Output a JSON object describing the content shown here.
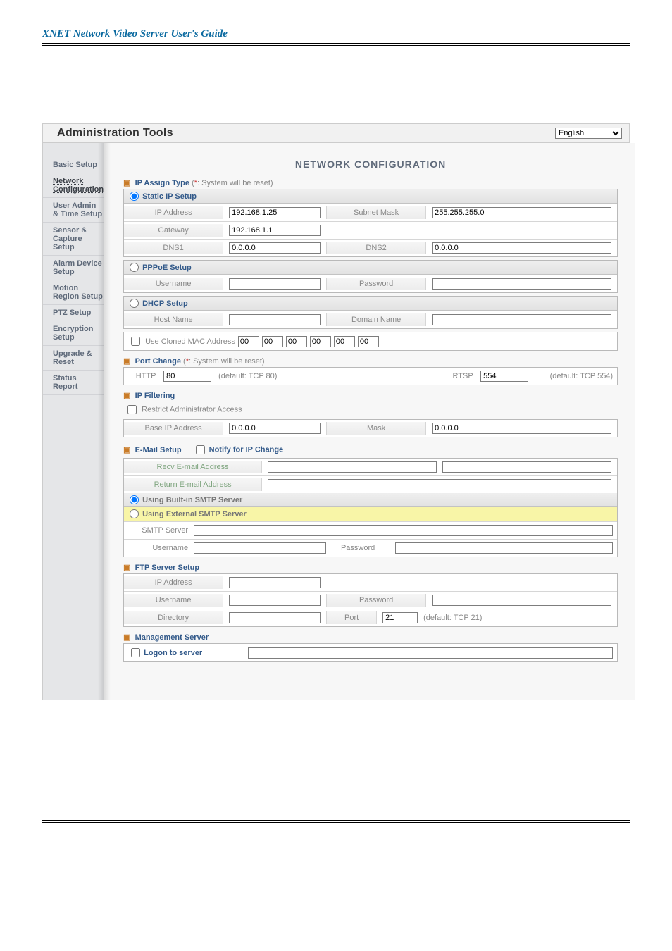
{
  "doc_title": "XNET Network Video Server User's Guide",
  "header": {
    "title": "Administration Tools",
    "language": "English"
  },
  "sidebar": {
    "items": [
      {
        "label": "Basic Setup"
      },
      {
        "label": "Network Configuration"
      },
      {
        "label": "User Admin & Time Setup"
      },
      {
        "label": "Sensor & Capture Setup"
      },
      {
        "label": "Alarm Device Setup"
      },
      {
        "label": "Motion Region Setup"
      },
      {
        "label": "PTZ Setup"
      },
      {
        "label": "Encryption Setup"
      },
      {
        "label": "Upgrade & Reset"
      },
      {
        "label": "Status Report"
      }
    ],
    "active_index": 1
  },
  "page_title": "NETWORK CONFIGURATION",
  "ip_assign": {
    "title": "IP Assign Type",
    "note_prefix": "*",
    "note_text": ": System will be reset)",
    "note_open": "(",
    "static": {
      "title": "Static IP Setup",
      "ip_label": "IP Address",
      "ip_value": "192.168.1.25",
      "subnet_label": "Subnet Mask",
      "subnet_value": "255.255.255.0",
      "gateway_label": "Gateway",
      "gateway_value": "192.168.1.1",
      "dns1_label": "DNS1",
      "dns1_value": "0.0.0.0",
      "dns2_label": "DNS2",
      "dns2_value": "0.0.0.0"
    },
    "pppoe": {
      "title": "PPPoE Setup",
      "user_label": "Username",
      "user_value": "",
      "pass_label": "Password",
      "pass_value": ""
    },
    "dhcp": {
      "title": "DHCP Setup",
      "host_label": "Host Name",
      "host_value": "",
      "domain_label": "Domain Name",
      "domain_value": ""
    },
    "mac": {
      "label": "Use Cloned MAC Address",
      "oct": [
        "00",
        "00",
        "00",
        "00",
        "00",
        "00"
      ]
    }
  },
  "port_change": {
    "title": "Port Change",
    "note_prefix": "*",
    "note_text": ": System will be reset)",
    "note_open": "(",
    "http_label": "HTTP",
    "http_value": "80",
    "http_hint": "(default: TCP 80)",
    "rtsp_label": "RTSP",
    "rtsp_value": "554",
    "rtsp_hint": "(default: TCP 554)"
  },
  "ip_filtering": {
    "title": "IP Filtering",
    "restrict_label": "Restrict Administrator Access",
    "base_label": "Base IP Address",
    "base_value": "0.0.0.0",
    "mask_label": "Mask",
    "mask_value": "0.0.0.0"
  },
  "email": {
    "title": "E-Mail Setup",
    "notify_label": "Notify for IP Change",
    "recv_label": "Recv E-mail Address",
    "recv_value": "",
    "return_label": "Return E-mail Address",
    "return_value": "",
    "builtin_label": "Using Built-in SMTP Server",
    "external_label": "Using External SMTP Server",
    "smtp_server_label": "SMTP Server",
    "smtp_server_value": "",
    "smtp_user_label": "Username",
    "smtp_user_value": "",
    "smtp_pass_label": "Password",
    "smtp_pass_value": ""
  },
  "ftp": {
    "title": "FTP Server Setup",
    "ip_label": "IP Address",
    "ip_value": "",
    "user_label": "Username",
    "user_value": "",
    "pass_label": "Password",
    "pass_value": "",
    "dir_label": "Directory",
    "dir_value": "",
    "port_label": "Port",
    "port_value": "21",
    "port_hint": "(default: TCP 21)"
  },
  "mgmt": {
    "title": "Management Server",
    "logon_label": "Logon to server",
    "server_value": ""
  }
}
